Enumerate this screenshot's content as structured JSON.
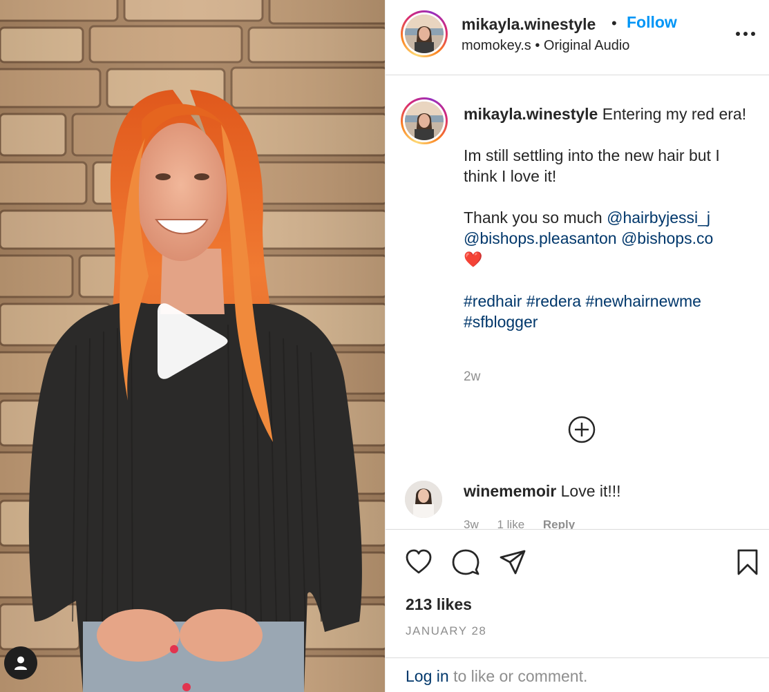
{
  "post": {
    "author": "mikayla.winestyle",
    "follow_label": "Follow",
    "separator": "•",
    "audio_user": "momokey.s",
    "audio_label": "Original Audio",
    "more_icon": "more-options-icon"
  },
  "caption": {
    "author": "mikayla.winestyle",
    "line1": "Entering my red era!",
    "line2": "Im still settling into the new hair but I think I love it!",
    "thanks": "Thank you so much",
    "mention1": "@hairbyjessi_j",
    "mention2": "@bishops.pleasanton",
    "mention3": "@bishops.co",
    "heart": "❤️",
    "hashtag1": "#redhair",
    "hashtag2": "#redera",
    "hashtag3": "#newhairnewme",
    "hashtag4": "#sfblogger",
    "time_ago": "2w"
  },
  "comment": {
    "user": "winememoir",
    "text": "Love it!!!",
    "age": "3w",
    "likes": "1 like",
    "reply": "Reply"
  },
  "actions": {
    "likes_text": "213 likes",
    "date": "JANUARY 28"
  },
  "login": {
    "link": "Log in",
    "rest": "to like or comment."
  },
  "colors": {
    "accent_blue": "#0095f6",
    "link_dark_blue": "#00376b",
    "muted_gray": "#8e8e8e",
    "text": "#262626"
  }
}
